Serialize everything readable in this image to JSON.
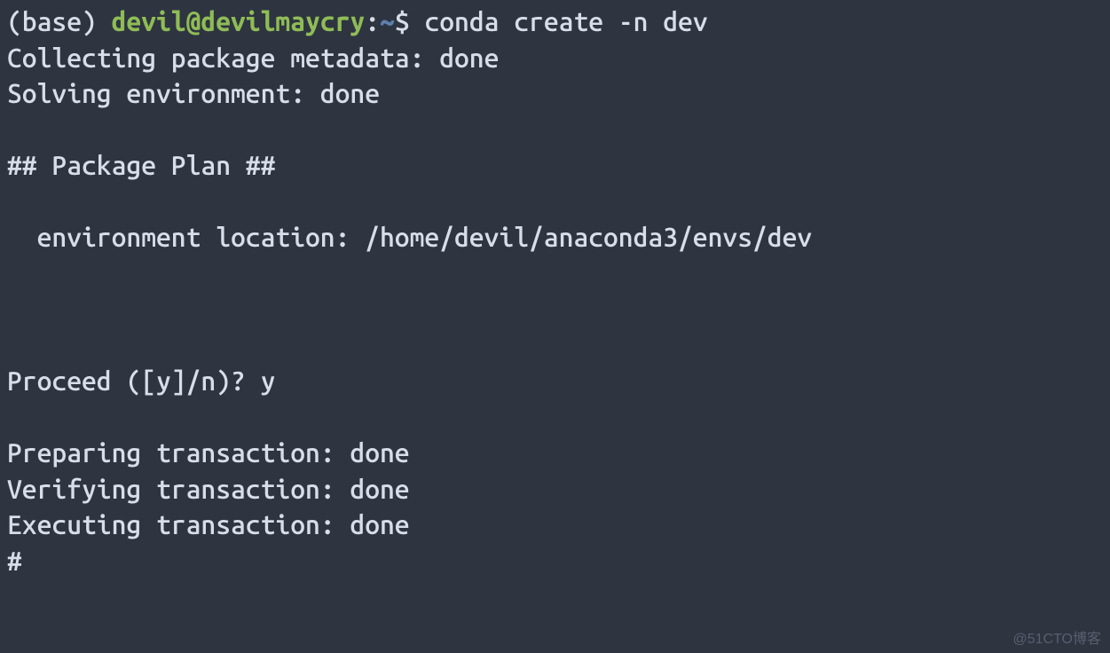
{
  "prompt": {
    "env_prefix": "(base) ",
    "user_host": "devil@devilmaycry",
    "colon": ":",
    "tilde": "~",
    "dollar": "$ ",
    "command": "conda create -n dev"
  },
  "output": {
    "line1": "Collecting package metadata: done",
    "line2": "Solving environment: done",
    "blank1": "",
    "plan_header": "## Package Plan ##",
    "blank2": "",
    "env_location": "  environment location: /home/devil/anaconda3/envs/dev",
    "blank3": "",
    "blank4": "",
    "blank5": "",
    "proceed": "Proceed ([y]/n)? y",
    "blank6": "",
    "preparing": "Preparing transaction: done",
    "verifying": "Verifying transaction: done",
    "executing": "Executing transaction: done",
    "hash": "#"
  },
  "watermark": "@51CTO博客"
}
